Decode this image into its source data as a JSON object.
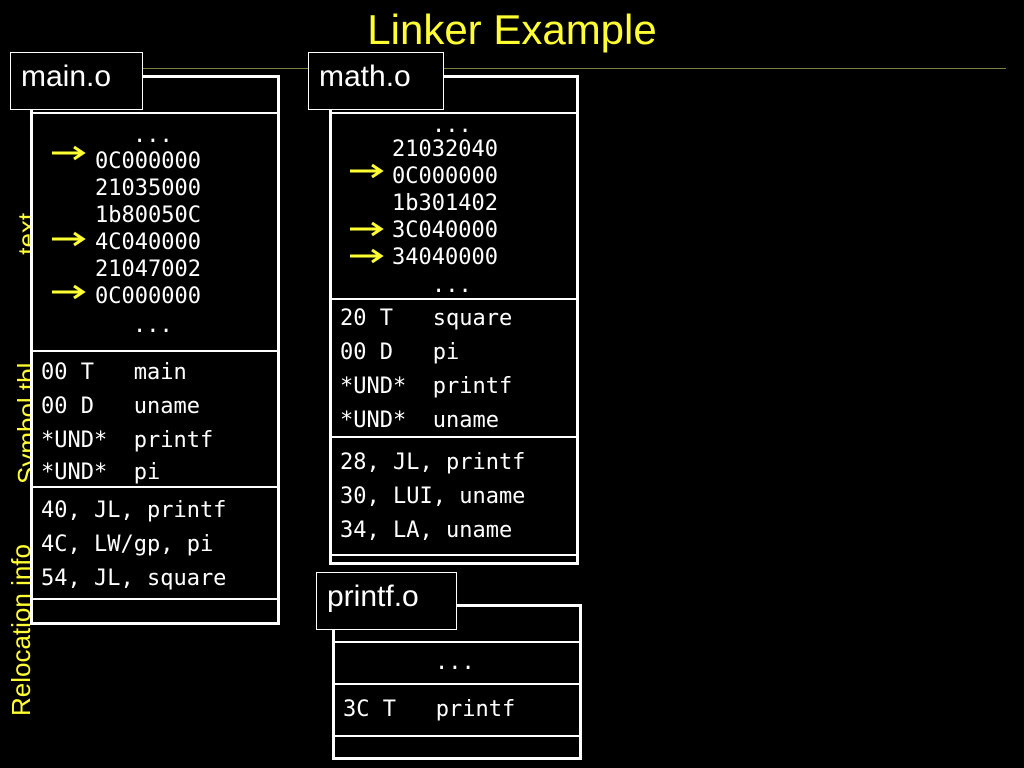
{
  "title": "Linker Example",
  "side_labels": {
    "text": ".text",
    "symtbl": "Symbol tbl",
    "reloc": "Relocation info"
  },
  "main_o": {
    "label": "main.o",
    "text_lines": [
      "...",
      "0C000000",
      "21035000",
      "1b80050C",
      "4C040000",
      "21047002",
      "0C000000",
      "..."
    ],
    "symbols": [
      "00 T   main",
      "00 D   uname",
      "*UND*  printf",
      "*UND*  pi"
    ],
    "relocs": [
      "40, JL, printf",
      "4C, LW/gp, pi",
      "54, JL, square"
    ]
  },
  "math_o": {
    "label": "math.o",
    "text_lines": [
      "...",
      "21032040",
      "0C000000",
      "1b301402",
      "3C040000",
      "34040000",
      "..."
    ],
    "symbols": [
      "20 T   square",
      "00 D   pi",
      "*UND*  printf",
      "*UND*  uname"
    ],
    "relocs": [
      "28, JL, printf",
      "30, LUI, uname",
      "34, LA, uname"
    ]
  },
  "printf_o": {
    "label": "printf.o",
    "text_lines": [
      "..."
    ],
    "symbols": [
      "3C T   printf"
    ]
  },
  "colors": {
    "accent": "#ffff33",
    "box": "#ffffff",
    "background": "#000000"
  }
}
